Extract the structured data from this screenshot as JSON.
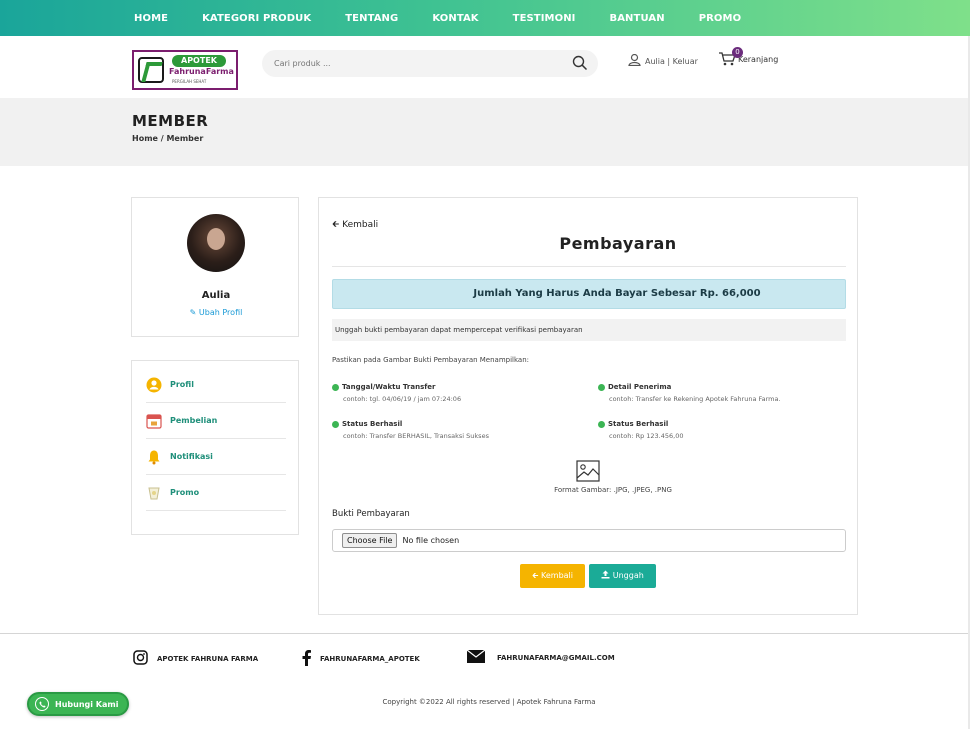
{
  "nav": {
    "items": [
      "HOME",
      "KATEGORI PRODUK",
      "TENTANG",
      "KONTAK",
      "TESTIMONI",
      "BANTUAN",
      "PROMO"
    ],
    "gradient_from": "#1aa59a",
    "gradient_to": "#7fe08a"
  },
  "logo": {
    "pill": "APOTEK",
    "brand": "FahrunaFarma",
    "tagline": "PERGILAH SEHAT"
  },
  "search": {
    "placeholder": "Cari produk ...",
    "icon": "search-icon"
  },
  "user": {
    "name": "Aulia",
    "separator": " | ",
    "logout": "Keluar",
    "icon": "user-icon"
  },
  "cart": {
    "label": "Keranjang",
    "count": "0",
    "icon": "cart-icon"
  },
  "page": {
    "title": "MEMBER",
    "breadcrumb": "Home / Member"
  },
  "profile": {
    "name": "Aulia",
    "edit_label": "Ubah Profil"
  },
  "sidemenu": {
    "items": [
      {
        "label": "Profil",
        "icon": "profile-icon"
      },
      {
        "label": "Pembelian",
        "icon": "calendar-icon"
      },
      {
        "label": "Notifikasi",
        "icon": "bell-icon"
      },
      {
        "label": "Promo",
        "icon": "promo-icon"
      }
    ]
  },
  "payment": {
    "back_link": "Kembali",
    "title": "Pembayaran",
    "amount_text": "Jumlah Yang Harus Anda Bayar Sebesar Rp. 66,000",
    "notice": "Unggah bukti pembayaran dapat mempercepat verifikasi pembayaran",
    "instruction": "Pastikan pada Gambar Bukti Pembayaran Menampilkan:",
    "conditions": [
      {
        "title": "Tanggal/Waktu Transfer",
        "example": "contoh: tgl. 04/06/19 / jam 07:24:06"
      },
      {
        "title": "Detail Penerima",
        "example": "contoh: Transfer ke Rekening Apotek Fahruna Farma."
      },
      {
        "title": "Status Berhasil",
        "example": "contoh: Transfer BERHASIL, Transaksi Sukses"
      },
      {
        "title": "Status Berhasil",
        "example": "contoh: Rp 123.456,00"
      }
    ],
    "format_text": "Format Gambar: .JPG, .JPEG, .PNG",
    "upload_label": "Bukti Pembayaran",
    "choose_file": "Choose File",
    "no_file": "No file chosen",
    "back_button": "Kembali",
    "upload_button": "Unggah",
    "accent_amount_bg": "#c9e8f0",
    "back_button_color": "#f5b400",
    "upload_button_color": "#1bab97"
  },
  "footer": {
    "instagram": "APOTEK FAHRUNA FARMA",
    "facebook": "FAHRUNAFARMA_APOTEK",
    "email": "FAHRUNAFARMA@GMAIL.COM",
    "copyright": "Copyright ©2022 All rights reserved | Apotek Fahruna Farma",
    "contact_button": "Hubungi Kami"
  }
}
